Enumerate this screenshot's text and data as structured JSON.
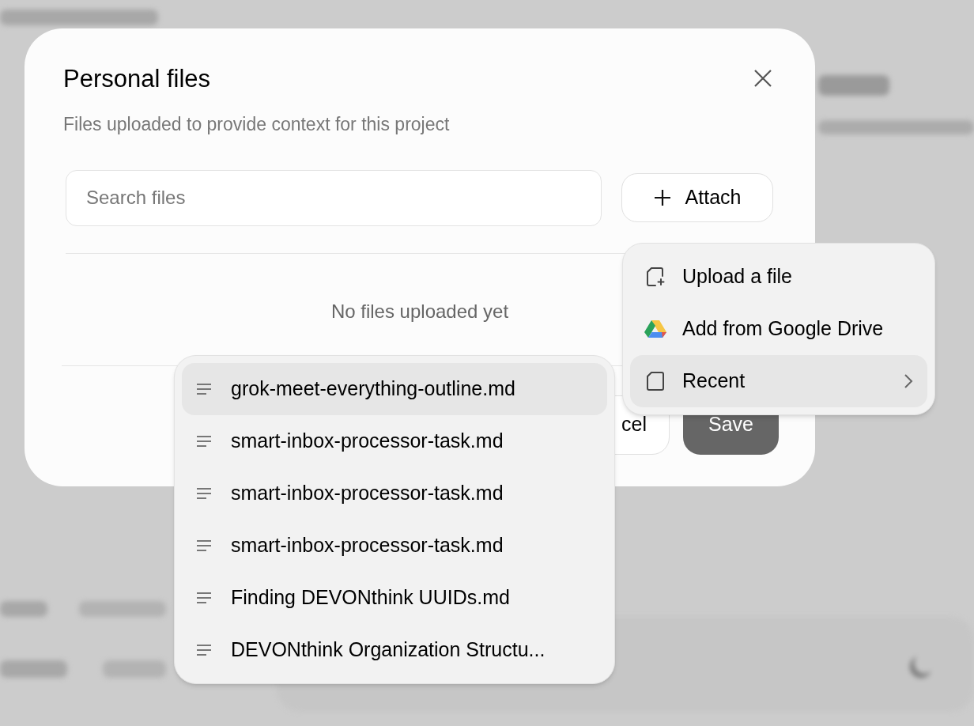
{
  "dialog": {
    "title": "Personal files",
    "subtitle": "Files uploaded to provide context for this project",
    "search": {
      "placeholder": "Search files"
    },
    "attach_button": "Attach",
    "empty_message": "No files uploaded yet",
    "buttons": [
      {
        "kind": "secondary",
        "label": "cel"
      },
      {
        "kind": "primary",
        "label": "Save"
      }
    ]
  },
  "attach_menu": [
    {
      "kind": "upload",
      "label": "Upload a file",
      "selected": false
    },
    {
      "kind": "drive",
      "label": "Add from Google Drive",
      "selected": false
    },
    {
      "kind": "recent",
      "label": "Recent",
      "selected": true
    }
  ],
  "recent_menu": [
    {
      "label": "grok-meet-everything-outline.md",
      "selected": true
    },
    {
      "label": "smart-inbox-processor-task.md",
      "selected": false
    },
    {
      "label": "smart-inbox-processor-task.md",
      "selected": false
    },
    {
      "label": "smart-inbox-processor-task.md",
      "selected": false
    },
    {
      "label": "Finding DEVONthink UUIDs.md",
      "selected": false
    },
    {
      "label": "DEVONthink Organization Structu...",
      "selected": false
    }
  ]
}
